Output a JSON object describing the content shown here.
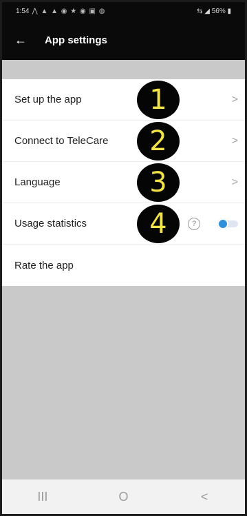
{
  "status_bar": {
    "time": "1:54",
    "notification_icons": "⋀ ▲ ▲ ◉ ★ ◉ ▣ ◍",
    "right": "⇆ ◢ 56% ▮"
  },
  "app_bar": {
    "back_icon": "←",
    "title": "App settings"
  },
  "settings_items": [
    {
      "label": "Set up the app",
      "marker": "1",
      "trailing": ">"
    },
    {
      "label": "Connect to TeleCare",
      "marker": "2",
      "trailing": ">"
    },
    {
      "label": "Language",
      "marker": "3",
      "trailing": ">"
    },
    {
      "label": "Usage statistics",
      "marker": "4",
      "help": "?",
      "toggle_on": true
    },
    {
      "label": "Rate the app"
    }
  ],
  "nav_bar": {
    "recents": "III",
    "home": "O",
    "back": "<"
  },
  "colors": {
    "app_bar_bg": "#0a0a0a",
    "background_gray": "#c9c9c9",
    "marker_bg": "#050505",
    "marker_text": "#f2e24a",
    "toggle_accent": "#2f8fd8"
  }
}
